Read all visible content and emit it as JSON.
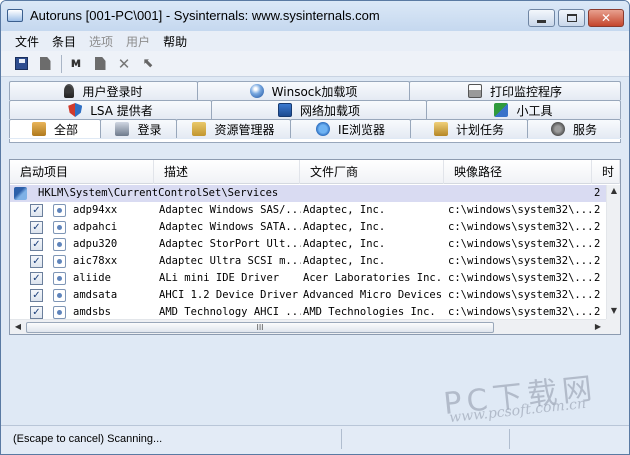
{
  "window": {
    "title": "Autoruns [001-PC\\001] - Sysinternals: www.sysinternals.com"
  },
  "menu": [
    {
      "label": "文件",
      "enabled": true
    },
    {
      "label": "条目",
      "enabled": true
    },
    {
      "label": "选项",
      "enabled": false
    },
    {
      "label": "用户",
      "enabled": false
    },
    {
      "label": "帮助",
      "enabled": true
    }
  ],
  "toolbar": [
    "save-icon",
    "document-icon",
    "find-icon",
    "copy-icon",
    "delete-icon",
    "jump-icon"
  ],
  "tabs": {
    "row1": [
      {
        "label": "用户登录时",
        "icon": "key-icon"
      },
      {
        "label": "Winsock加载项",
        "icon": "globe-icon"
      },
      {
        "label": "打印监控程序",
        "icon": "printer-icon"
      }
    ],
    "row2": [
      {
        "label": "LSA 提供者",
        "icon": "shield-icon"
      },
      {
        "label": "网络加载项",
        "icon": "network-icon"
      },
      {
        "label": "小工具",
        "icon": "tool-icon"
      }
    ],
    "row3": [
      {
        "label": "全部",
        "icon": "all-icon",
        "active": true
      },
      {
        "label": "登录",
        "icon": "login-icon"
      },
      {
        "label": "资源管理器",
        "icon": "explorer-icon"
      },
      {
        "label": "IE浏览器",
        "icon": "ie-icon"
      },
      {
        "label": "计划任务",
        "icon": "scheduled-task-icon"
      },
      {
        "label": "服务",
        "icon": "services-icon"
      }
    ]
  },
  "list": {
    "columns": [
      "启动项目",
      "描述",
      "文件厂商",
      "映像路径",
      "时"
    ],
    "group": "HKLM\\System\\CurrentControlSet\\Services",
    "group_extra": "2",
    "rows": [
      {
        "checked": true,
        "name": "adp94xx",
        "description": "Adaptec Windows SAS/...",
        "vendor": "Adaptec, Inc.",
        "path": "c:\\windows\\system32\\...",
        "extra": "2"
      },
      {
        "checked": true,
        "name": "adpahci",
        "description": "Adaptec Windows SATA...",
        "vendor": "Adaptec, Inc.",
        "path": "c:\\windows\\system32\\...",
        "extra": "2"
      },
      {
        "checked": true,
        "name": "adpu320",
        "description": "Adaptec StorPort Ult...",
        "vendor": "Adaptec, Inc.",
        "path": "c:\\windows\\system32\\...",
        "extra": "2"
      },
      {
        "checked": true,
        "name": "aic78xx",
        "description": "Adaptec Ultra SCSI m...",
        "vendor": "Adaptec, Inc.",
        "path": "c:\\windows\\system32\\...",
        "extra": "2"
      },
      {
        "checked": true,
        "name": "aliide",
        "description": "ALi mini IDE Driver",
        "vendor": "Acer Laboratories Inc.",
        "path": "c:\\windows\\system32\\...",
        "extra": "2"
      },
      {
        "checked": true,
        "name": "amdsata",
        "description": "AHCI 1.2 Device Driver",
        "vendor": "Advanced Micro Devices",
        "path": "c:\\windows\\system32\\...",
        "extra": "2"
      },
      {
        "checked": true,
        "name": "amdsbs",
        "description": "AMD Technology AHCI ...",
        "vendor": "AMD Technologies Inc.",
        "path": "c:\\windows\\system32\\...",
        "extra": "2"
      }
    ],
    "hscroll_grip": "III"
  },
  "watermark": {
    "main": "PC下载网",
    "url": "www.pcsoft.com.cn"
  },
  "status": {
    "text": "(Escape to cancel) Scanning..."
  }
}
